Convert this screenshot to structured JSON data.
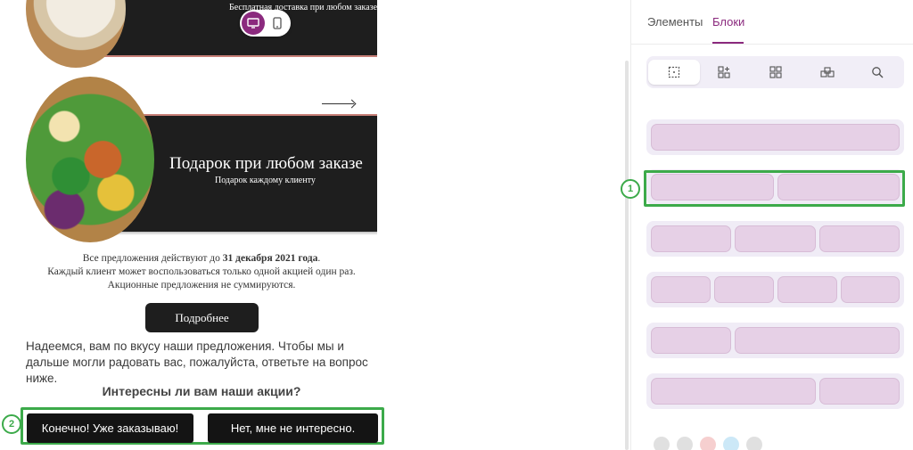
{
  "email": {
    "banner1_text": "Бесплатная доставка при любом заказе",
    "banner2_title": "Подарок при любом заказе",
    "banner2_subtitle": "Подарок каждому клиенту",
    "terms": {
      "line1_prefix": "Все предложения действуют до ",
      "line1_bold": "31 декабря 2021 года",
      "line1_suffix": ".",
      "line2": "Каждый клиент может воспользоваться только одной акцией один раз.",
      "line3": "Акционные предложения не суммируются."
    },
    "more_button": "Подробнее",
    "hope_text": "Надеемся, вам по вкусу наши предложения. Чтобы мы и дальше могли радовать вас, пожалуйста, ответьте на вопрос ниже.",
    "question": "Интересны ли вам наши акции?",
    "answer_yes": "Конечно! Уже заказываю!",
    "answer_no": "Нет, мне не интересно."
  },
  "preview_toggle": {
    "options": [
      "desktop-icon",
      "mobile-icon"
    ],
    "active": "desktop"
  },
  "markers": {
    "blocks_marker": "1",
    "answers_marker": "2"
  },
  "panel": {
    "tabs": [
      {
        "label": "Элементы",
        "active": false
      },
      {
        "label": "Блоки",
        "active": true
      }
    ],
    "toolbar_icons": [
      "single-column-icon",
      "add-grid-icon",
      "grid-icon",
      "layers-icon",
      "search-icon"
    ],
    "block_layouts": [
      {
        "columns": 1
      },
      {
        "columns": 2
      },
      {
        "columns": 3
      },
      {
        "columns": 4
      },
      {
        "columns": 2,
        "layout": "narrow-wide"
      },
      {
        "columns": 2,
        "layout": "wide-narrow"
      }
    ]
  },
  "colors": {
    "accent": "#8b2a7e",
    "highlight": "#3caa4a",
    "block_cell": "#e6d0e6",
    "dark_banner": "#1e1e1e"
  }
}
